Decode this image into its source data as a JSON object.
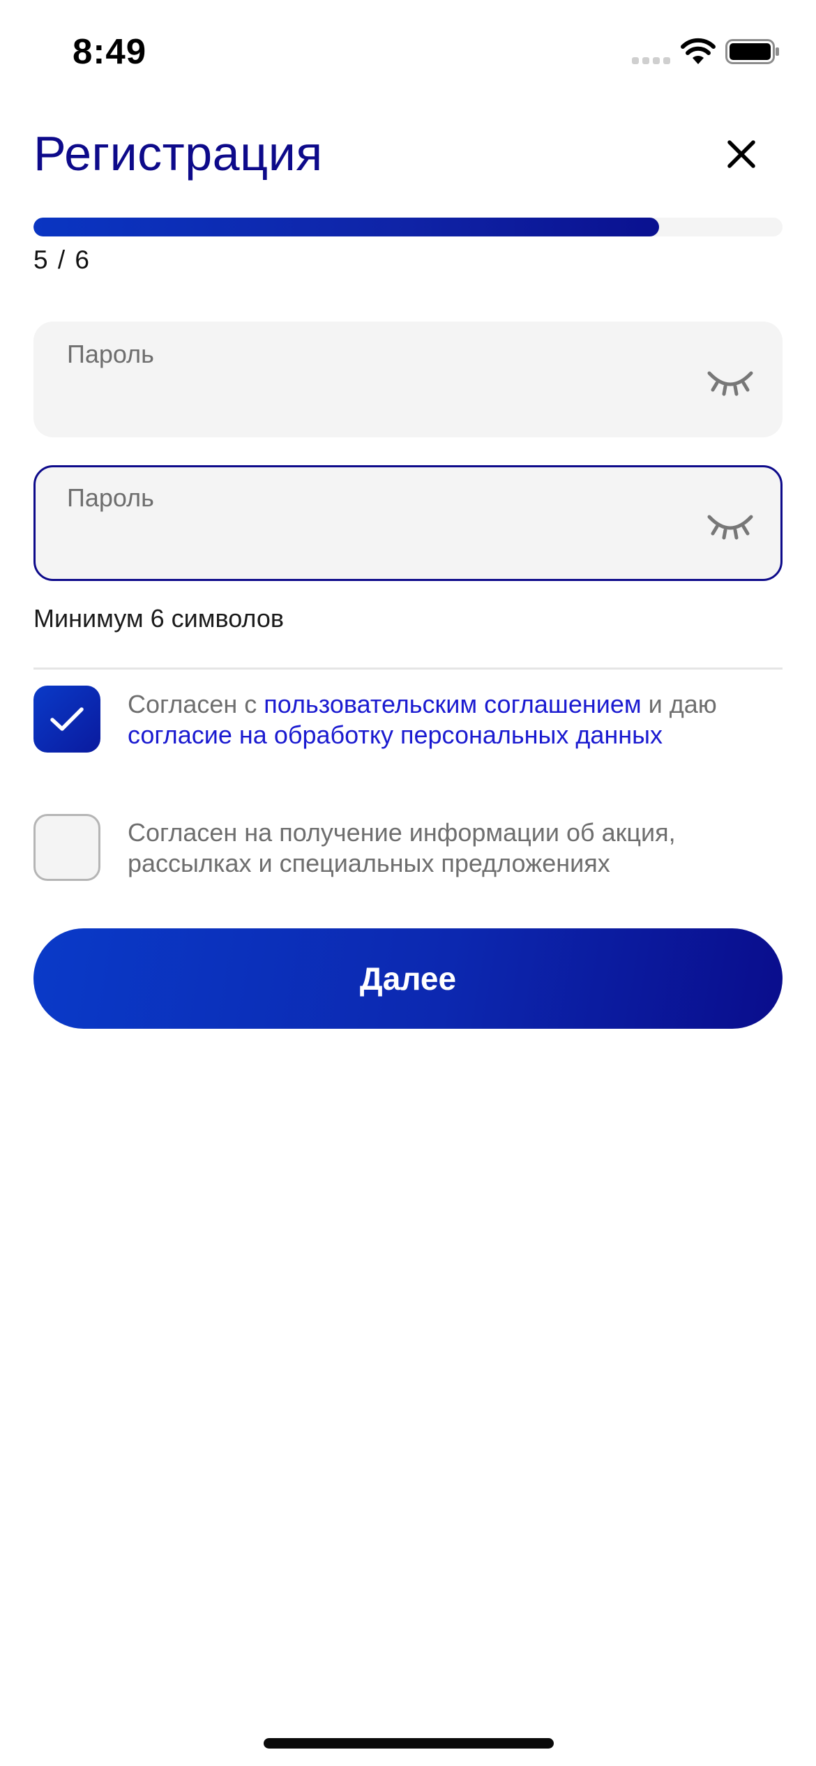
{
  "status_bar": {
    "time": "8:49"
  },
  "header": {
    "title": "Регистрация",
    "close_icon": "close-icon"
  },
  "progress": {
    "text": "5 / 6",
    "current_step": 5,
    "total_steps": 6,
    "fraction": 0.835
  },
  "fields": [
    {
      "label": "Пароль",
      "value": "",
      "icon": "eye-closed-icon",
      "focused": false
    },
    {
      "label": "Пароль",
      "value": "",
      "icon": "eye-closed-icon",
      "focused": true
    }
  ],
  "hint": "Минимум 6 символов",
  "consents": {
    "agreement": {
      "checked": true,
      "text_before": "Согласен с ",
      "link_terms": "пользовательским соглашением",
      "text_middle": " и даю ",
      "link_personal_data": "согласие на обработку персональных данных"
    },
    "marketing": {
      "checked": false,
      "text": "Согласен на получение информации об акция, рассылках и специальных предложениях"
    }
  },
  "next_button": {
    "label": "Далее"
  },
  "colors": {
    "brand_dark": "#0d0a8a",
    "brand_blue": "#0a3ac8",
    "link": "#1a1ad0",
    "field_bg": "#f4f4f4",
    "muted_text": "#6e6e6e"
  }
}
